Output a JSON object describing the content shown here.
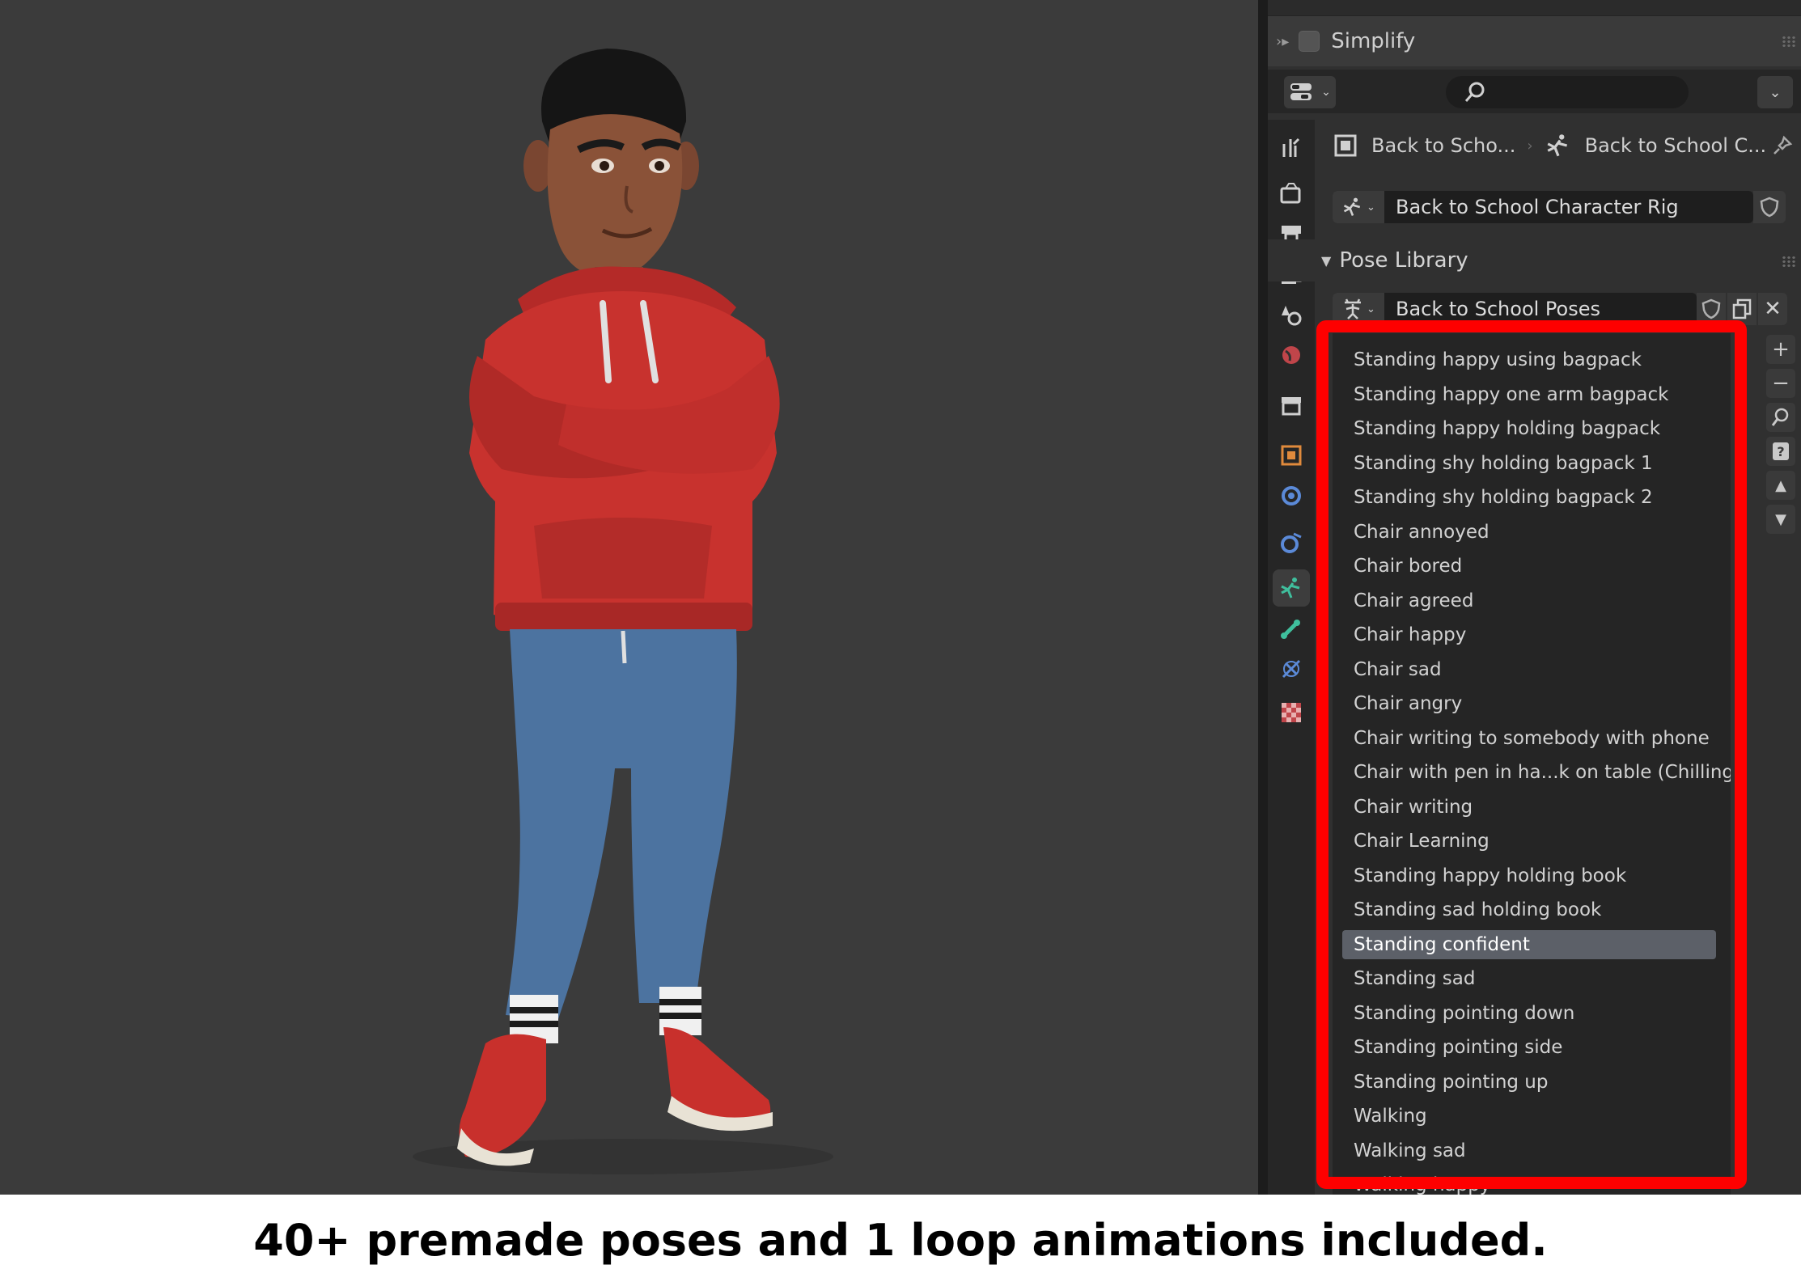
{
  "panel": {
    "simplify_label": "Simplify",
    "breadcrumbs": {
      "object": "Back to Scho...",
      "armature": "Back to School C..."
    },
    "rig_name": "Back to School Character Rig",
    "pose_library_title": "Pose Library",
    "pose_library_name": "Back to School Poses",
    "poses": [
      "Standing happy using bagpack",
      "Standing happy one arm bagpack",
      "Standing happy holding bagpack",
      "Standing shy holding bagpack 1",
      "Standing shy holding bagpack 2",
      "Chair annoyed",
      "Chair bored",
      "Chair agreed",
      "Chair happy",
      "Chair sad",
      "Chair angry",
      "Chair writing to somebody with phone",
      "Chair with pen in ha...k on table (Chilling)",
      "Chair writing",
      "Chair Learning",
      "Standing happy holding book",
      "Standing sad holding book",
      "Standing confident",
      "Standing sad",
      "Standing pointing down",
      "Standing pointing side",
      "Standing pointing up",
      "Walking",
      "Walking sad",
      "Walking happy"
    ],
    "selected_pose": "Standing confident",
    "side_buttons": [
      "+",
      "−"
    ]
  },
  "caption": "40+ premade poses and 1 loop animations included.",
  "colors": {
    "highlight": "#fe0000",
    "selected_row": "#5c6068",
    "hoodie": "#c8322e",
    "jeans": "#4c73a0"
  },
  "icons": [
    "search-icon",
    "pin-icon",
    "armature-icon",
    "object-icon",
    "shield-icon",
    "copy-icon",
    "close-icon",
    "move-up-icon",
    "move-down-icon"
  ]
}
